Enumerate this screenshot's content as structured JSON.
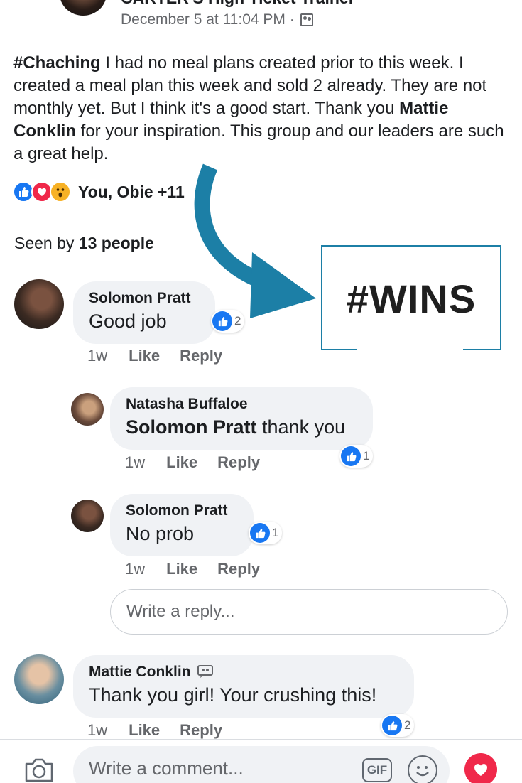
{
  "post": {
    "author": "CARTER'S High Ticket Trainer",
    "meta": "December 5 at 11:04 PM ·",
    "body": {
      "tag": "#Chaching",
      "text1": " I had no meal plans created prior to this week.  I created a meal plan this week and sold 2 already. They are not monthly yet. But I think it's a good start. Thank you ",
      "mention": "Mattie Conklin",
      "text2": " for your inspiration. This group and our leaders are such a great help."
    },
    "reactions": {
      "icons": [
        "like-icon",
        "love-icon",
        "wow-icon"
      ],
      "names": "You, Obie +11"
    },
    "seen": {
      "prefix": "Seen by ",
      "count": "13 people"
    }
  },
  "comments": [
    {
      "name": "Solomon Pratt",
      "text": "Good job",
      "likes": "2",
      "time": "1w",
      "like": "Like",
      "reply": "Reply"
    },
    {
      "name": "Natasha Buffaloe",
      "mention": "Solomon Pratt",
      "text": " thank you",
      "likes": "1",
      "time": "1w",
      "like": "Like",
      "reply": "Reply"
    },
    {
      "name": "Solomon Pratt",
      "text": "No prob",
      "likes": "1",
      "time": "1w",
      "like": "Like",
      "reply": "Reply"
    },
    {
      "name": "Mattie Conklin",
      "text": "Thank you girl! Your crushing this!",
      "likes": "2",
      "time": "1w",
      "like": "Like",
      "reply": "Reply"
    }
  ],
  "reply_box": {
    "placeholder": "Write a reply..."
  },
  "overlay": {
    "text": "#WINS",
    "accent": "#1c7fa6"
  },
  "composer": {
    "placeholder": "Write a comment...",
    "gif": "GIF"
  },
  "colors": {
    "like": "#1877f2",
    "love": "#f0284a",
    "wow": "#f7b125",
    "muted": "#65676b"
  }
}
